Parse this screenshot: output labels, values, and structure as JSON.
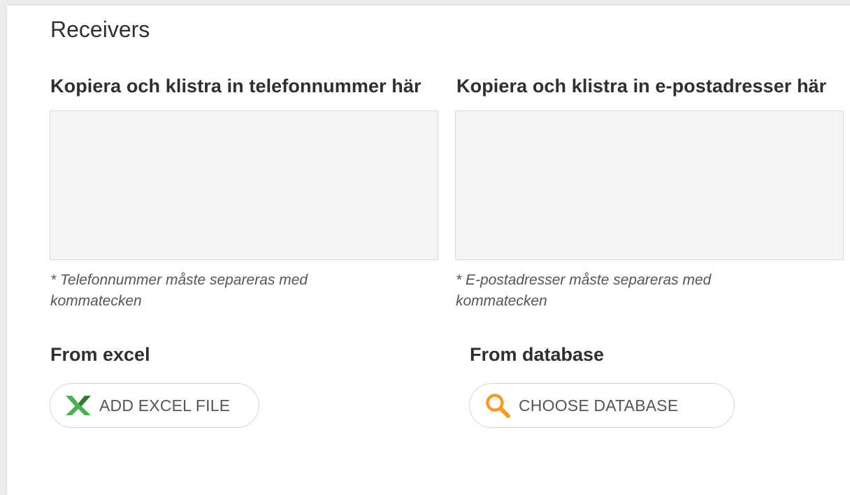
{
  "receivers": {
    "title": "Receivers",
    "phone": {
      "label": "Kopiera och klistra in telefonnummer här",
      "value": "",
      "hint": "* Telefonnummer måste separeras med kommatecken"
    },
    "email": {
      "label": "Kopiera och klistra in e-postadresser här",
      "value": "",
      "hint": "* E-postadresser måste separeras med kommatecken"
    }
  },
  "excel": {
    "heading": "From excel",
    "button_label": "ADD EXCEL FILE",
    "icon": "excel-icon",
    "icon_color": "#4caf50"
  },
  "database": {
    "heading": "From database",
    "button_label": "CHOOSE DATABASE",
    "icon": "search-icon",
    "icon_color": "#f39a2b"
  }
}
